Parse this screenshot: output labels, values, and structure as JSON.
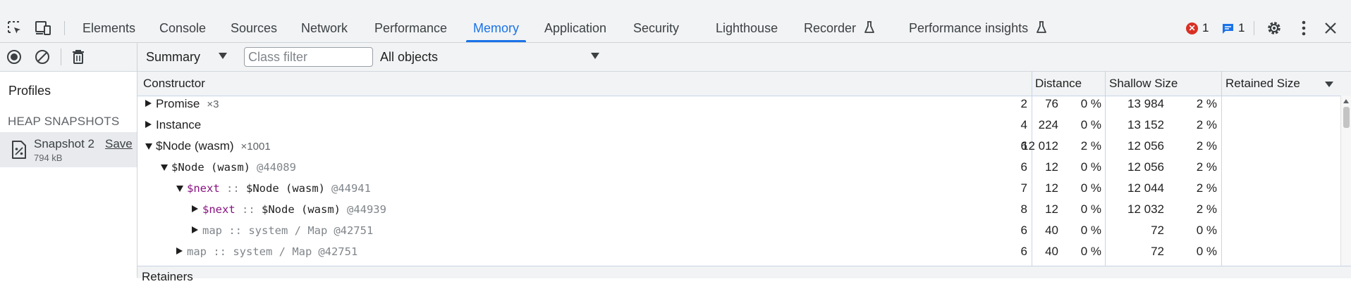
{
  "tabbar": {
    "tabs": [
      {
        "label": "Elements",
        "active": false
      },
      {
        "label": "Console",
        "active": false
      },
      {
        "label": "Sources",
        "active": false
      },
      {
        "label": "Network",
        "active": false
      },
      {
        "label": "Performance",
        "active": false
      },
      {
        "label": "Memory",
        "active": true
      },
      {
        "label": "Application",
        "active": false
      },
      {
        "label": "Security",
        "active": false
      },
      {
        "label": "Lighthouse",
        "active": false
      },
      {
        "label": "Recorder",
        "active": false
      },
      {
        "label": "Performance insights",
        "active": false
      }
    ],
    "error_count": "1",
    "message_count": "1",
    "icons": [
      "inspect-element-icon",
      "device-toolbar-icon",
      "flask-icon",
      "error-icon",
      "message-icon",
      "gear-icon",
      "kebab-menu-icon",
      "close-icon"
    ]
  },
  "sidebar": {
    "toolbar_icons": [
      "record-icon",
      "clear-icon",
      "trash-icon"
    ],
    "profiles_label": "Profiles",
    "heap_header": "HEAP SNAPSHOTS",
    "snapshot": {
      "name": "Snapshot 2",
      "save": "Save",
      "size": "794 kB"
    }
  },
  "filters": {
    "view": "Summary",
    "class_filter_placeholder": "Class filter",
    "objects": "All objects"
  },
  "table": {
    "columns": [
      "Constructor",
      "Distance",
      "Shallow Size",
      "Retained Size"
    ],
    "sort_column": "Retained Size",
    "sort_direction": "descending",
    "rows": [
      {
        "depth": 0,
        "expand": "collapsed",
        "kind": "plain",
        "label": "Promise",
        "count": "×3",
        "distance": "2",
        "shallow": "76",
        "shallow_pct": "0 %",
        "retained": "13 984",
        "retained_pct": "2 %"
      },
      {
        "depth": 0,
        "expand": "collapsed",
        "kind": "plain",
        "label": "Instance",
        "count": "",
        "distance": "4",
        "shallow": "224",
        "shallow_pct": "0 %",
        "retained": "13 152",
        "retained_pct": "2 %"
      },
      {
        "depth": 0,
        "expand": "expanded",
        "kind": "plain",
        "label": "$Node (wasm)",
        "count": "×1001",
        "distance": "6",
        "shallow": "12 012",
        "shallow_pct": "2 %",
        "retained": "12 056",
        "retained_pct": "2 %"
      },
      {
        "depth": 1,
        "expand": "expanded",
        "kind": "instance",
        "label": "$Node (wasm)",
        "id": "@44089",
        "distance": "6",
        "shallow": "12",
        "shallow_pct": "0 %",
        "retained": "12 056",
        "retained_pct": "2 %"
      },
      {
        "depth": 2,
        "expand": "expanded",
        "kind": "edge",
        "edge": "$next",
        "sep": " :: ",
        "label": "$Node (wasm)",
        "id": "@44941",
        "distance": "7",
        "shallow": "12",
        "shallow_pct": "0 %",
        "retained": "12 044",
        "retained_pct": "2 %"
      },
      {
        "depth": 3,
        "expand": "collapsed",
        "kind": "edge",
        "edge": "$next",
        "sep": " :: ",
        "label": "$Node (wasm)",
        "id": "@44939",
        "distance": "8",
        "shallow": "12",
        "shallow_pct": "0 %",
        "retained": "12 032",
        "retained_pct": "2 %"
      },
      {
        "depth": 3,
        "expand": "collapsed",
        "kind": "system",
        "edge": "map",
        "sep": " :: ",
        "label": "system / Map",
        "id": "@42751",
        "distance": "6",
        "shallow": "40",
        "shallow_pct": "0 %",
        "retained": "72",
        "retained_pct": "0 %"
      },
      {
        "depth": 2,
        "expand": "collapsed",
        "kind": "system",
        "edge": "map",
        "sep": " :: ",
        "label": "system / Map",
        "id": "@42751",
        "distance": "6",
        "shallow": "40",
        "shallow_pct": "0 %",
        "retained": "72",
        "retained_pct": "0 %"
      }
    ]
  },
  "retainers": {
    "label": "Retainers"
  }
}
